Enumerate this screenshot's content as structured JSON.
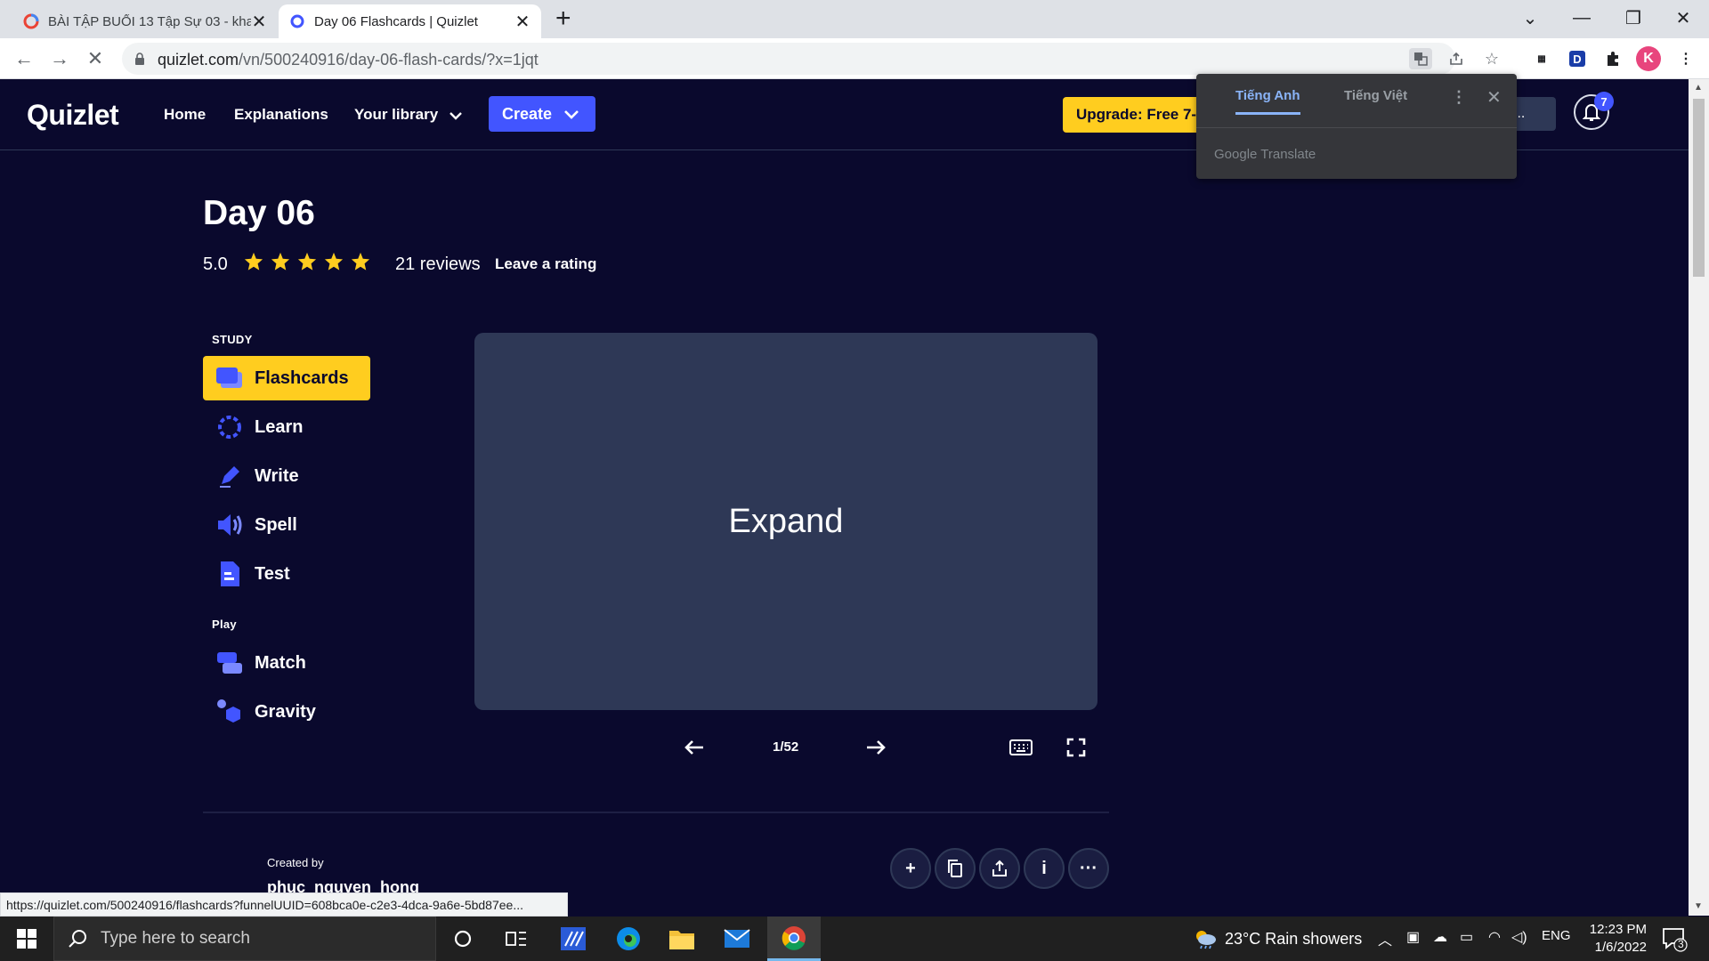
{
  "browser": {
    "tabs": [
      {
        "title": "BÀI TẬP BUỔI 13 Tập Sự 03 - kha",
        "active": false
      },
      {
        "title": "Day 06 Flashcards | Quizlet",
        "active": true
      }
    ],
    "new_tab_label": "+",
    "url_host": "quizlet.com",
    "url_path": "/vn/500240916/day-06-flash-cards/?x=1jqt",
    "profile_initial": "K",
    "status_url": "https://quizlet.com/500240916/flashcards?funnelUUID=608bca0e-c2e3-4dca-9a6e-5bd87ee..."
  },
  "header": {
    "logo": "Quizlet",
    "nav": [
      "Home",
      "Explanations",
      "Your library"
    ],
    "create_label": "Create",
    "upgrade_label": "Upgrade: Free 7-",
    "search_fragment": "...",
    "notification_count": "7"
  },
  "translate_popup": {
    "tab_source": "Tiếng Anh",
    "tab_target": "Tiếng Việt",
    "brand": "Google Translate"
  },
  "set": {
    "title": "Day 06",
    "rating": "5.0",
    "stars": 5,
    "reviews": "21 reviews",
    "leave_rating": "Leave a rating",
    "created_by_label": "Created by",
    "author": "phuc_nguyen_hong"
  },
  "study": {
    "section_label": "STUDY",
    "modes": [
      {
        "label": "Flashcards",
        "active": true
      },
      {
        "label": "Learn",
        "active": false
      },
      {
        "label": "Write",
        "active": false
      },
      {
        "label": "Spell",
        "active": false
      },
      {
        "label": "Test",
        "active": false
      }
    ],
    "play_label": "Play",
    "play_modes": [
      {
        "label": "Match"
      },
      {
        "label": "Gravity"
      }
    ]
  },
  "card": {
    "text": "Expand",
    "counter": "1/52"
  },
  "taskbar": {
    "search_placeholder": "Type here to search",
    "weather": "23°C  Rain showers",
    "language": "ENG",
    "time": "12:23 PM",
    "date": "1/6/2022",
    "notification_count": "3"
  },
  "colors": {
    "background": "#0a092d",
    "card": "#2e3856",
    "accent_blue": "#4255ff",
    "accent_yellow": "#ffcd1f"
  }
}
